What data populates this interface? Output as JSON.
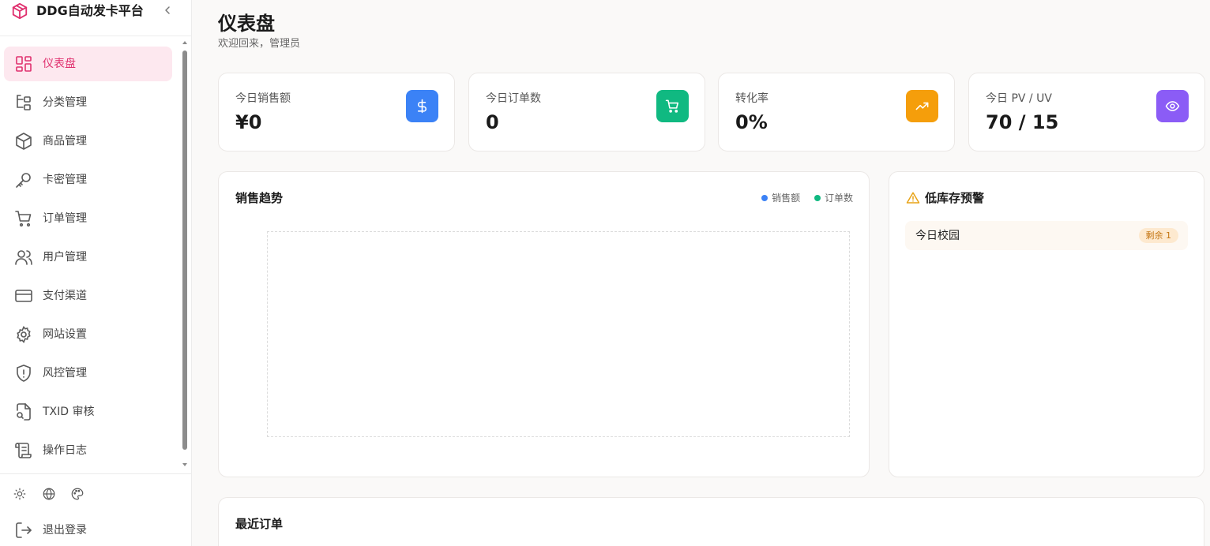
{
  "app": {
    "name": "DDG自动发卡平台"
  },
  "sidebar": {
    "items": [
      {
        "label": "仪表盘",
        "icon": "dashboard-icon",
        "active": true
      },
      {
        "label": "分类管理",
        "icon": "category-icon"
      },
      {
        "label": "商品管理",
        "icon": "box-icon"
      },
      {
        "label": "卡密管理",
        "icon": "key-icon"
      },
      {
        "label": "订单管理",
        "icon": "cart-icon"
      },
      {
        "label": "用户管理",
        "icon": "users-icon"
      },
      {
        "label": "支付渠道",
        "icon": "credit-card-icon"
      },
      {
        "label": "网站设置",
        "icon": "gear-icon"
      },
      {
        "label": "风控管理",
        "icon": "shield-alert-icon"
      },
      {
        "label": "TXID 审核",
        "icon": "file-search-icon"
      },
      {
        "label": "操作日志",
        "icon": "scroll-icon"
      }
    ],
    "utility_icons": [
      "sun-icon",
      "globe-icon",
      "palette-icon"
    ],
    "logout_label": "退出登录"
  },
  "header": {
    "title": "仪表盘",
    "subtitle": "欢迎回来，管理员"
  },
  "stats": [
    {
      "label": "今日销售额",
      "value": "¥0",
      "icon": "dollar-icon",
      "color": "#3b82f6"
    },
    {
      "label": "今日订单数",
      "value": "0",
      "icon": "cart-icon",
      "color": "#10b981"
    },
    {
      "label": "转化率",
      "value": "0%",
      "icon": "trending-up-icon",
      "color": "#f59e0b"
    },
    {
      "label": "今日 PV / UV",
      "value": "70 / 15",
      "icon": "eye-icon",
      "color": "#8b5cf6"
    }
  ],
  "sales_trend": {
    "title": "销售趋势",
    "legend": [
      {
        "label": "销售额",
        "color": "#3b82f6"
      },
      {
        "label": "订单数",
        "color": "#10b981"
      }
    ]
  },
  "low_stock": {
    "title": "低库存预警",
    "items": [
      {
        "name": "今日校园",
        "badge": "剩余 1"
      }
    ]
  },
  "recent_orders": {
    "title": "最近订单"
  }
}
